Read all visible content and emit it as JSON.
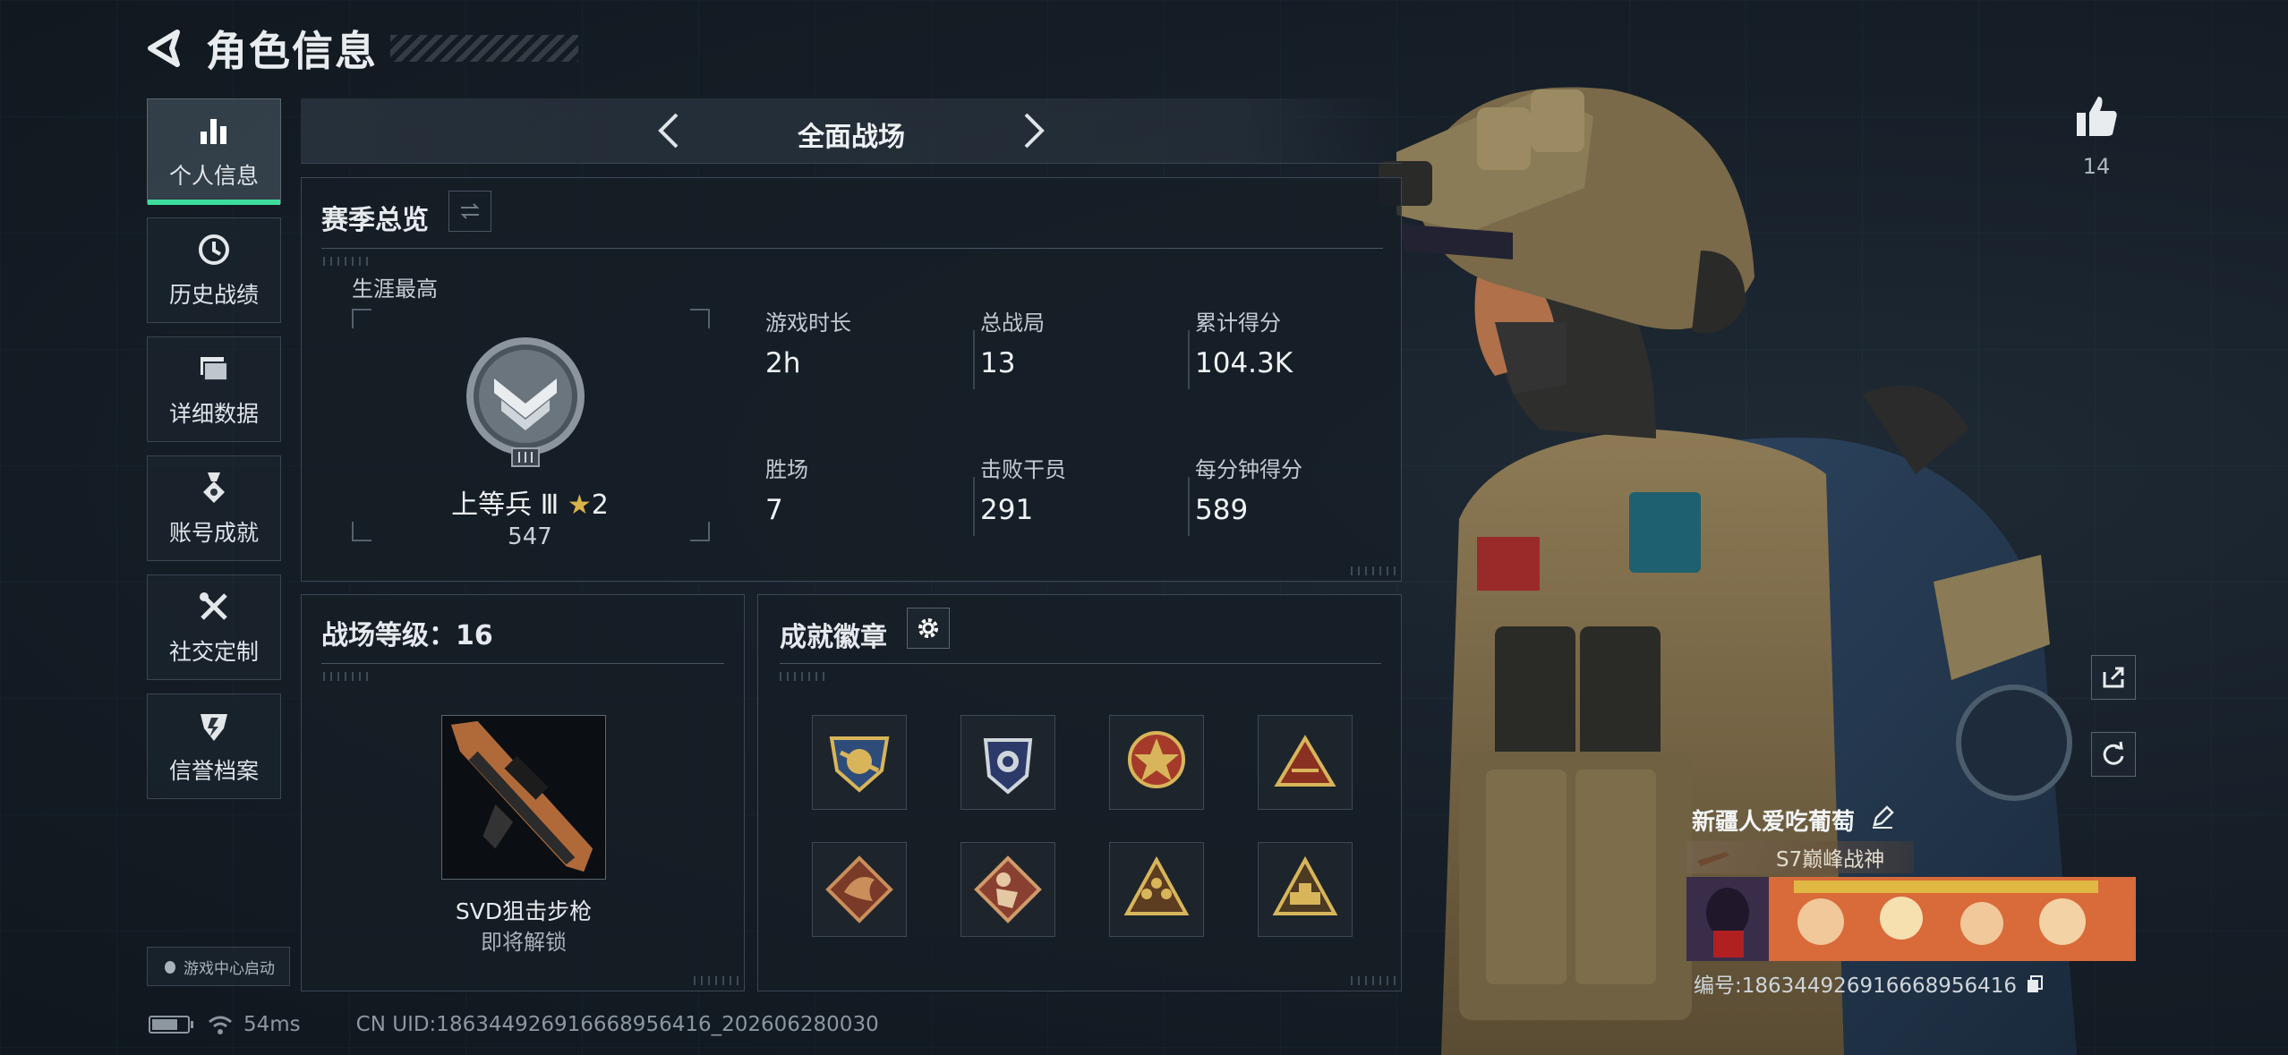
{
  "header": {
    "title": "角色信息"
  },
  "sidebar": {
    "items": [
      {
        "label": "个人信息",
        "icon": "bar-chart-icon",
        "active": true
      },
      {
        "label": "历史战绩",
        "icon": "history-clock-icon",
        "active": false
      },
      {
        "label": "详细数据",
        "icon": "folder-stack-icon",
        "active": false
      },
      {
        "label": "账号成就",
        "icon": "achievement-medal-icon",
        "active": false
      },
      {
        "label": "社交定制",
        "icon": "tools-crossed-icon",
        "active": false
      },
      {
        "label": "信誉档案",
        "icon": "shield-emblem-icon",
        "active": false
      }
    ],
    "game_center": "游戏中心启动"
  },
  "mode": {
    "title": "全面战场"
  },
  "season": {
    "title": "赛季总览",
    "career_label": "生涯最高",
    "rank_name": "上等兵 Ⅲ",
    "rank_stars": "2",
    "rank_score": "547",
    "stats": [
      {
        "label": "游戏时长",
        "value": "2h"
      },
      {
        "label": "总战局",
        "value": "13"
      },
      {
        "label": "累计得分",
        "value": "104.3K"
      },
      {
        "label": "胜场",
        "value": "7"
      },
      {
        "label": "击败干员",
        "value": "291"
      },
      {
        "label": "每分钟得分",
        "value": "589"
      }
    ]
  },
  "level": {
    "title": "战场等级：16",
    "weapon_name": "SVD狙击步枪",
    "weapon_status": "即将解锁"
  },
  "badges": {
    "title": "成就徽章",
    "items": [
      "shield-badge",
      "police-badge",
      "star-badge",
      "triangle-badge",
      "dragon-badge",
      "soldier-badge",
      "squad-badge",
      "tank-badge"
    ]
  },
  "footer": {
    "ping": "54ms",
    "uid": "CN UID:18634492691666895641​6_202606280030"
  },
  "profile": {
    "likes": "14",
    "player_name": "新疆人爱吃葡萄",
    "title_tag": "S7巅峰战神",
    "player_id": "编号:186344926916668956416"
  },
  "colors": {
    "accent": "#3ddc9c",
    "gold": "#d9b24a",
    "panel_border": "#3c4753"
  }
}
